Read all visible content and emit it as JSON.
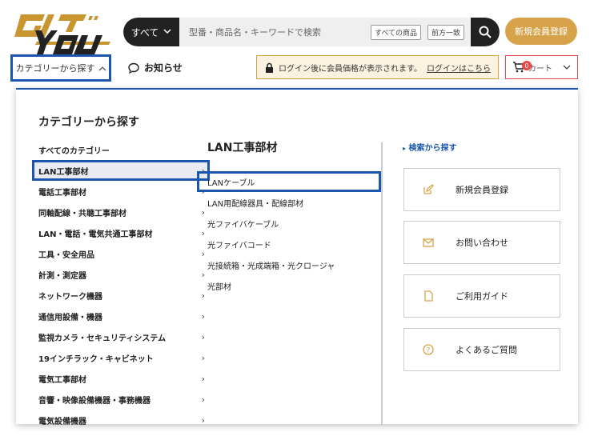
{
  "header": {
    "logo_text": "GIGYOU",
    "search": {
      "category": "すべて",
      "placeholder": "型番・商品名・キーワードで検索",
      "chip_all": "すべての商品",
      "chip_prefix": "前方一致"
    },
    "signup_label": "新規会員登録"
  },
  "nav": {
    "category_toggle": "カテゴリーから探す",
    "news_label": "お知らせ",
    "notice_text": "ログイン後に会員価格が表示されます。",
    "notice_link": "ログインはこちら",
    "cart_label": "カート",
    "cart_count": "0"
  },
  "menu": {
    "title": "カテゴリーから探す",
    "all_label": "すべてのカテゴリー",
    "categories": [
      "LAN工事部材",
      "電話工事部材",
      "同軸配線・共聴工事部材",
      "LAN・電話・電気共通工事部材",
      "工具・安全用品",
      "計測・測定器",
      "ネットワーク機器",
      "通信用設備・機器",
      "監視カメラ・セキュリティシステム",
      "19インチラック・キャビネット",
      "電気工事部材",
      "音響・映像設備機器・事務機器",
      "電気設備機器"
    ],
    "sub_title": "LAN工事部材",
    "subcategories": [
      "LANケーブル",
      "LAN用配線器具・配線部材",
      "光ファイバケーブル",
      "光ファイバコード",
      "光接続箱・光成端箱・光クロージャ",
      "光部材"
    ],
    "search_link": "検索から探す",
    "side_buttons": [
      {
        "label": "新規会員登録",
        "icon": "edit-icon"
      },
      {
        "label": "お問い合わせ",
        "icon": "mail-icon"
      },
      {
        "label": "ご利用ガイド",
        "icon": "document-icon"
      },
      {
        "label": "よくあるご質問",
        "icon": "question-icon"
      }
    ]
  },
  "colors": {
    "accent_gold": "#d6a34a",
    "highlight_blue": "#1a56b0",
    "cart_red": "#e84848"
  }
}
